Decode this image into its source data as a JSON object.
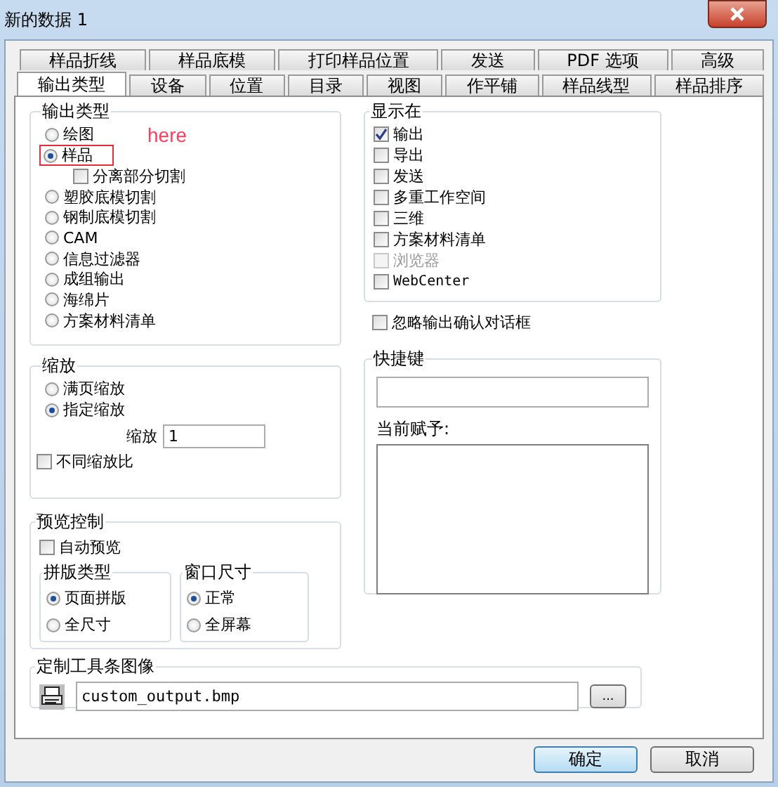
{
  "window": {
    "title": "新的数据 1"
  },
  "tab_rows": [
    [
      {
        "label": "样品折线",
        "selected": false
      },
      {
        "label": "样品底模",
        "selected": false
      },
      {
        "label": "打印样品位置",
        "selected": false
      },
      {
        "label": "发送",
        "selected": false
      },
      {
        "label": "PDF 选项",
        "selected": false
      },
      {
        "label": "高级",
        "selected": false
      }
    ],
    [
      {
        "label": "输出类型",
        "selected": true
      },
      {
        "label": "设备",
        "selected": false
      },
      {
        "label": "位置",
        "selected": false
      },
      {
        "label": "目录",
        "selected": false
      },
      {
        "label": "视图",
        "selected": false
      },
      {
        "label": "作平铺",
        "selected": false
      },
      {
        "label": "样品线型",
        "selected": false
      },
      {
        "label": "样品排序",
        "selected": false
      }
    ]
  ],
  "output_type": {
    "title": "输出类型",
    "annotation": "here",
    "options": [
      {
        "kind": "radio",
        "label": "绘图",
        "selected": false
      },
      {
        "kind": "radio",
        "label": "样品",
        "selected": true,
        "annotated": true
      },
      {
        "kind": "checkbox",
        "label": "分离部分切割",
        "checked": false
      },
      {
        "kind": "radio",
        "label": "塑胶底模切割",
        "selected": false
      },
      {
        "kind": "radio",
        "label": "钢制底模切割",
        "selected": false
      },
      {
        "kind": "radio",
        "label": "CAM",
        "selected": false
      },
      {
        "kind": "radio",
        "label": "信息过滤器",
        "selected": false
      },
      {
        "kind": "radio",
        "label": "成组输出",
        "selected": false
      },
      {
        "kind": "radio",
        "label": "海绵片",
        "selected": false
      },
      {
        "kind": "radio",
        "label": "方案材料清单",
        "selected": false
      }
    ]
  },
  "show_in": {
    "title": "显示在",
    "items": [
      {
        "label": "输出",
        "checked": true,
        "disabled": false
      },
      {
        "label": "导出",
        "checked": false,
        "disabled": false
      },
      {
        "label": "发送",
        "checked": false,
        "disabled": false
      },
      {
        "label": "多重工作空间",
        "checked": false,
        "disabled": false
      },
      {
        "label": "三维",
        "checked": false,
        "disabled": false
      },
      {
        "label": "方案材料清单",
        "checked": false,
        "disabled": false
      },
      {
        "label": "浏览器",
        "checked": false,
        "disabled": true
      },
      {
        "label": "WebCenter",
        "checked": false,
        "disabled": false
      }
    ]
  },
  "ignore_confirm": {
    "label": "忽略输出确认对话框",
    "checked": false
  },
  "scale": {
    "title": "缩放",
    "options": [
      {
        "label": "满页缩放",
        "selected": false
      },
      {
        "label": "指定缩放",
        "selected": true
      }
    ],
    "scale_label": "缩放",
    "scale_value": "1",
    "different_ratio": {
      "label": "不同缩放比",
      "checked": false
    }
  },
  "shortcut": {
    "title": "快捷键",
    "value_label": "当前赋予:"
  },
  "preview": {
    "title": "预览控制",
    "auto_preview": {
      "label": "自动预览",
      "checked": false
    },
    "layout_type": {
      "title": "拼版类型",
      "options": [
        {
          "label": "页面拼版",
          "selected": true
        },
        {
          "label": "全尺寸",
          "selected": false
        }
      ]
    },
    "window_size": {
      "title": "窗口尺寸",
      "options": [
        {
          "label": "正常",
          "selected": true
        },
        {
          "label": "全屏幕",
          "selected": false
        }
      ]
    }
  },
  "toolbar_image": {
    "title": "定制工具条图像",
    "value": "custom_output.bmp",
    "browse": "..."
  },
  "buttons": [
    {
      "label": "确定",
      "default": true
    },
    {
      "label": "取消",
      "default": false
    }
  ]
}
